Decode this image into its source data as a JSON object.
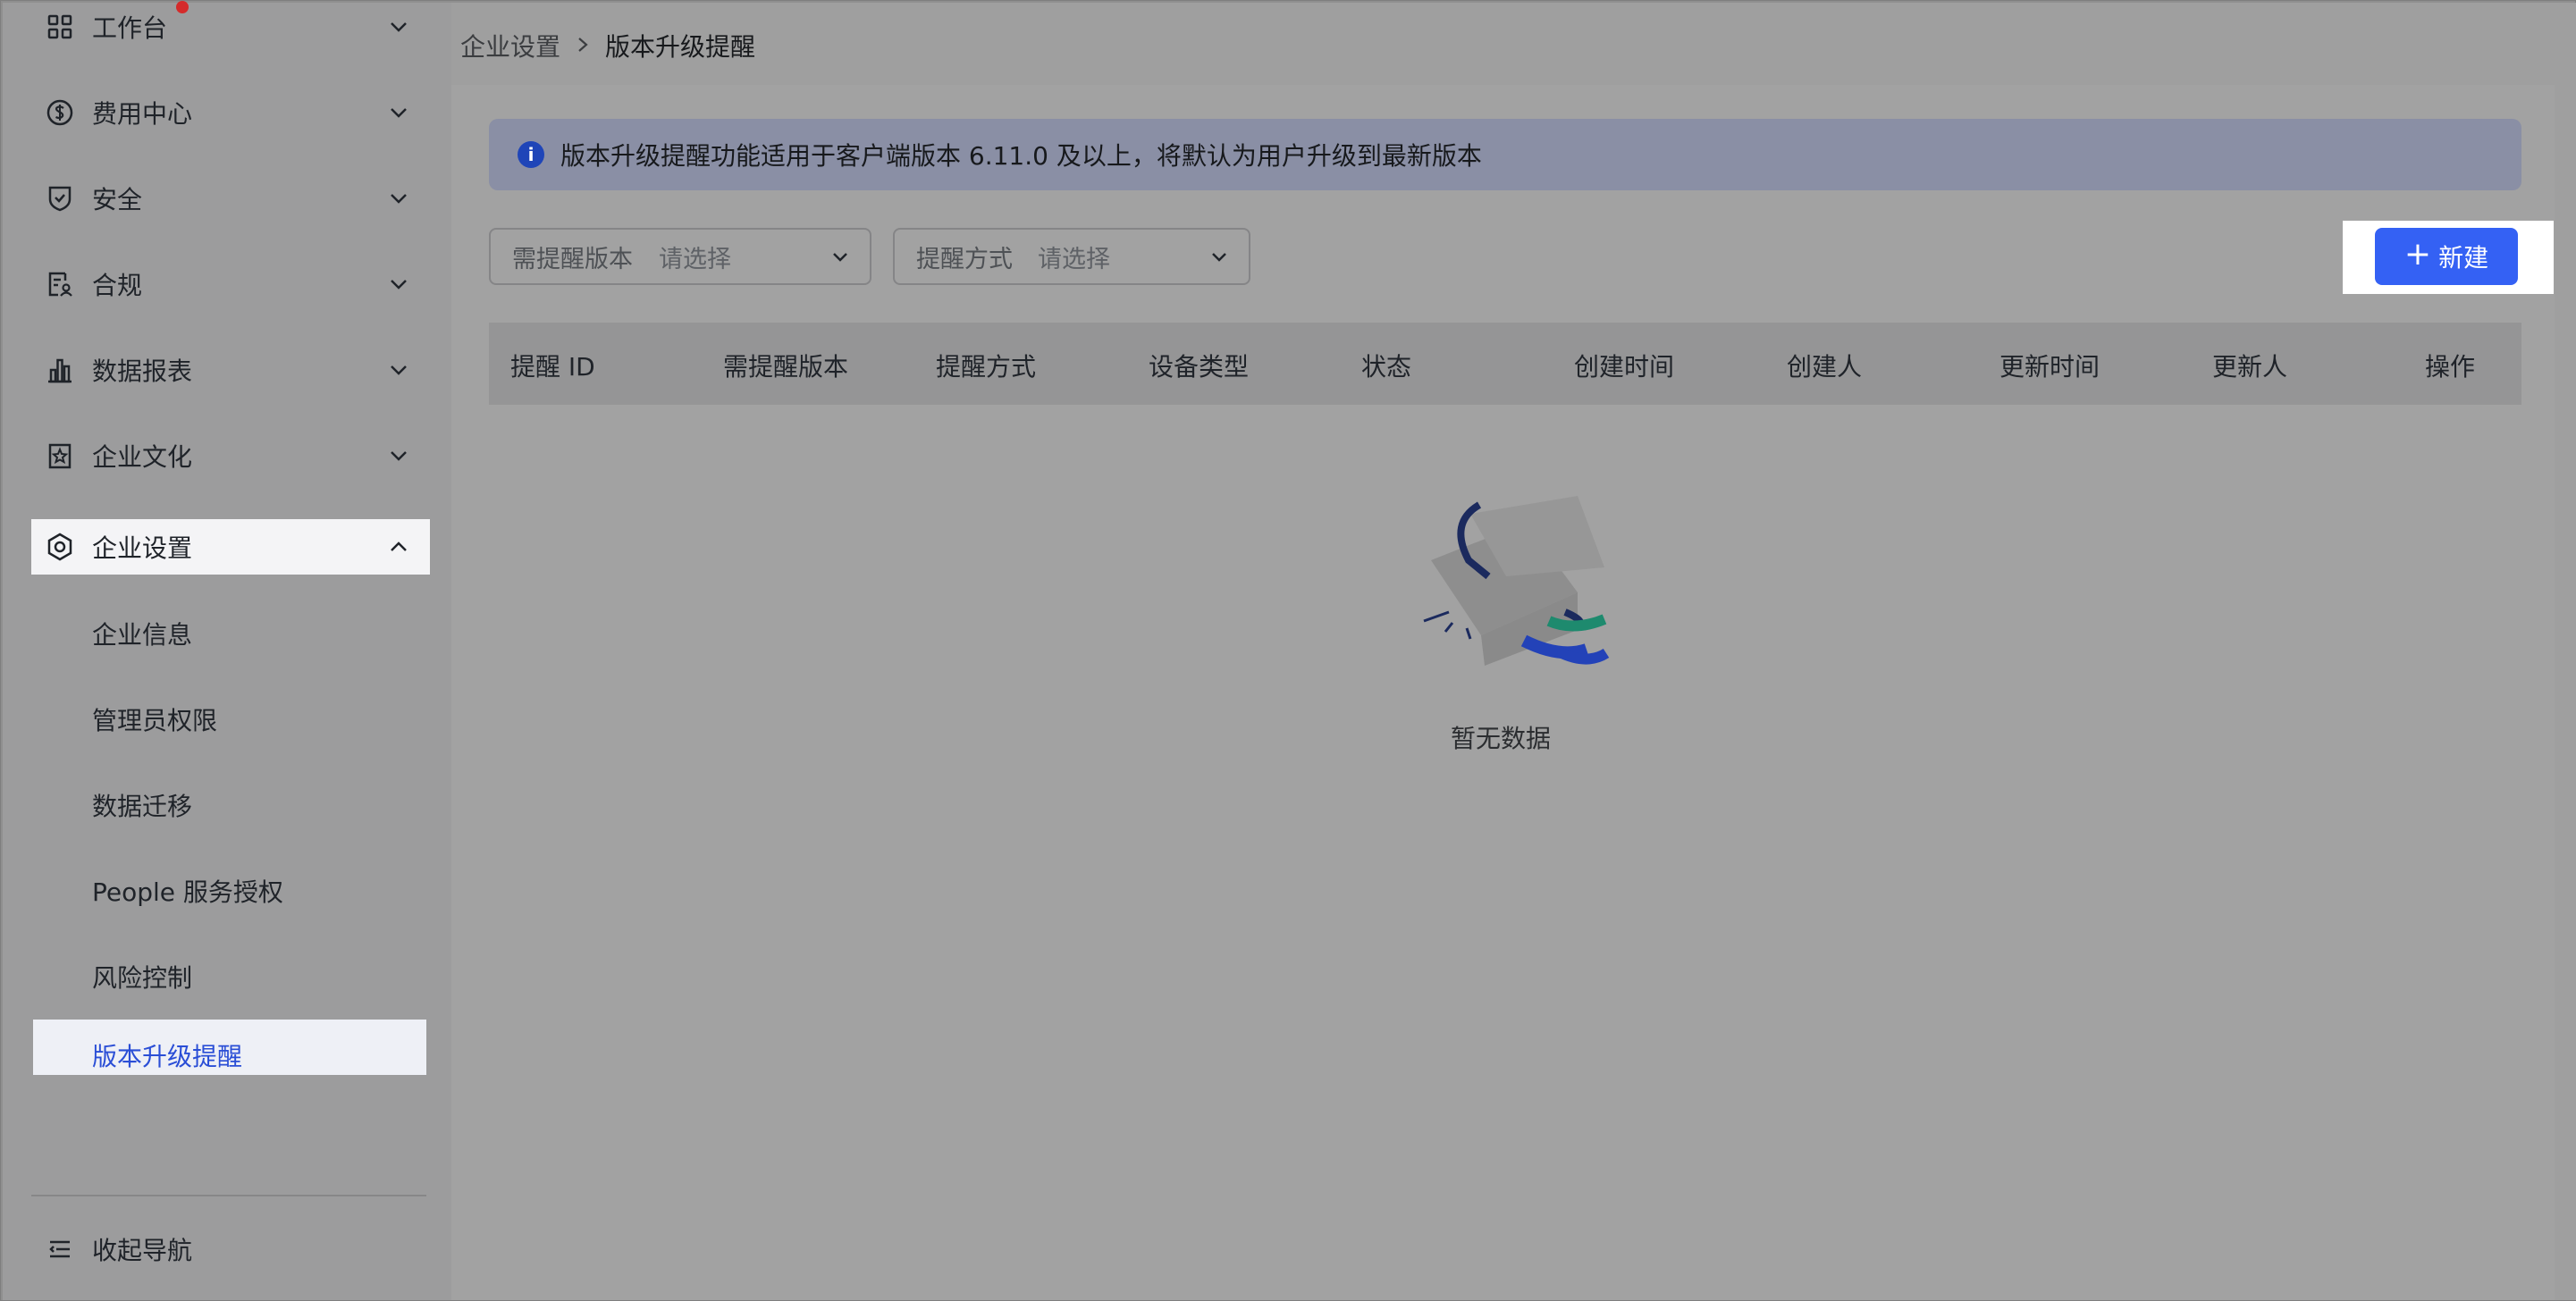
{
  "sidebar": {
    "items": [
      {
        "label": "工作台",
        "icon": "grid-icon",
        "badge": true
      },
      {
        "label": "费用中心",
        "icon": "dollar-icon"
      },
      {
        "label": "安全",
        "icon": "shield-icon"
      },
      {
        "label": "合规",
        "icon": "compliance-icon"
      },
      {
        "label": "数据报表",
        "icon": "bar-chart-icon"
      },
      {
        "label": "企业文化",
        "icon": "culture-icon"
      },
      {
        "label": "企业设置",
        "icon": "hexagon-settings-icon",
        "expanded": true
      }
    ],
    "sub_items": [
      {
        "label": "企业信息"
      },
      {
        "label": "管理员权限"
      },
      {
        "label": "数据迁移"
      },
      {
        "label": "People 服务授权"
      },
      {
        "label": "风险控制"
      },
      {
        "label": "版本升级提醒",
        "active": true
      }
    ],
    "collapse_label": "收起导航"
  },
  "breadcrumb": {
    "parent": "企业设置",
    "current": "版本升级提醒"
  },
  "info": {
    "text": "版本升级提醒功能适用于客户端版本 6.11.0 及以上，将默认为用户升级到最新版本"
  },
  "filters": {
    "version": {
      "label": "需提醒版本",
      "value": "请选择"
    },
    "method": {
      "label": "提醒方式",
      "value": "请选择"
    }
  },
  "new_button": {
    "label": "新建"
  },
  "table": {
    "columns": [
      "提醒 ID",
      "需提醒版本",
      "提醒方式",
      "设备类型",
      "状态",
      "创建时间",
      "创建人",
      "更新时间",
      "更新人",
      "操作"
    ]
  },
  "empty": {
    "text": "暂无数据"
  },
  "colors": {
    "accent": "#3461f4",
    "active_text": "#2a4ed6",
    "badge": "#d42b2b"
  }
}
